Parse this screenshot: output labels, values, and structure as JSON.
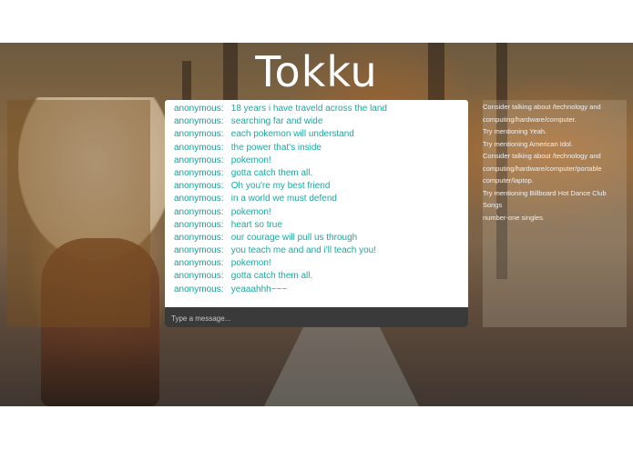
{
  "app": {
    "title": "Tokku"
  },
  "chat": {
    "messages": [
      {
        "user": "anonymous:",
        "text": "18 years i have traveld across the land"
      },
      {
        "user": "anonymous:",
        "text": "searching far and wide"
      },
      {
        "user": "anonymous:",
        "text": "each pokemon will understand"
      },
      {
        "user": "anonymous:",
        "text": "the power that's inside"
      },
      {
        "user": "anonymous:",
        "text": "pokemon!"
      },
      {
        "user": "anonymous:",
        "text": "gotta catch them all."
      },
      {
        "user": "anonymous:",
        "text": "Oh you're my best friend"
      },
      {
        "user": "anonymous:",
        "text": "in a world we must defend"
      },
      {
        "user": "anonymous:",
        "text": "pokemon!"
      },
      {
        "user": "anonymous:",
        "text": "heart so true"
      },
      {
        "user": "anonymous:",
        "text": "our courage will pull us through"
      },
      {
        "user": "anonymous:",
        "text": "you teach me and and i'll teach you!"
      },
      {
        "user": "anonymous:",
        "text": "pokemon!"
      },
      {
        "user": "anonymous:",
        "text": "gotta catch them all."
      },
      {
        "user": "anonymous:",
        "text": "yeaaahhh~~~"
      }
    ],
    "input": {
      "placeholder": "Type a message...",
      "value": ""
    }
  },
  "suggestions": [
    "Consider talking about /technology and",
    "computing/hardware/computer.",
    "Try mentioning Yeah.",
    "Try mentioning American Idol.",
    "Consider talking about /technology and",
    "computing/hardware/computer/portable",
    "computer/laptop.",
    "Try mentioning Billboard Hot Dance Club Songs",
    "number-one singles."
  ],
  "colors": {
    "accent": "#19a8a0",
    "input_bar": "#3a3a3a",
    "title": "#ffffff"
  }
}
